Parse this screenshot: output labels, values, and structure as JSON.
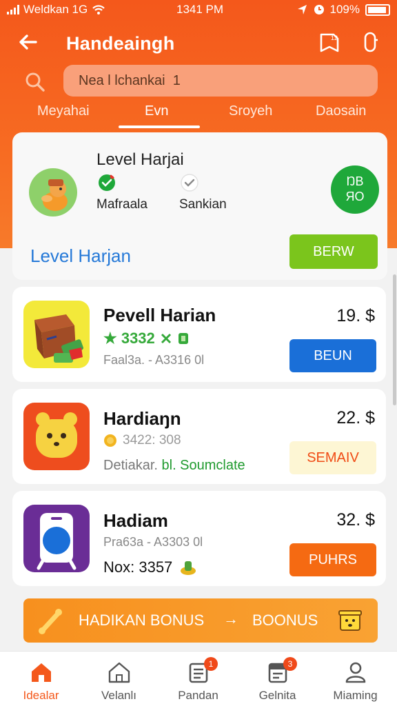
{
  "status_bar": {
    "carrier": "Weldkan 1G",
    "time": "1341 PM",
    "battery": "109%"
  },
  "header": {
    "title": "Handeaingh",
    "back_icon": "arrow-left-icon",
    "icons": [
      "bookmark-icon",
      "phone-icon"
    ]
  },
  "search": {
    "value": "Nea l lchankai  1",
    "icon": "search-icon"
  },
  "tabs": [
    {
      "label": "Meyahai",
      "active": false
    },
    {
      "label": "Evn",
      "active": true
    },
    {
      "label": "Sroyeh",
      "active": false
    },
    {
      "label": "Daosain",
      "active": false
    }
  ],
  "level_card": {
    "title": "Level Harjai",
    "check1_label": "Mafraala",
    "check2_label": "Sankian",
    "xp_line1": "ŊB",
    "xp_line2": "ЯO",
    "link_text": "Level Harjan",
    "button_label": "BERW"
  },
  "items": [
    {
      "name": "Pevell Harian",
      "price": "19. $",
      "stars_text": "★ 3332",
      "subtitle": "Faal3a. - A3316 0l",
      "button": "BEUN",
      "button_color": "#1a6fd8"
    },
    {
      "name": "Hardiaŋn",
      "price": "22. $",
      "coin_text": "3422: 308",
      "detail_prefix": "Detiakar.",
      "detail_link": "bl. Soumclate",
      "button": "SEMAIV",
      "button_color": "#fdf6d4"
    },
    {
      "name": "Hadiam",
      "price": "32. $",
      "subtitle": "Pra63a - A3303 0l",
      "nox": "Nox: 3357",
      "button": "PUHRS",
      "button_color": "#f56a12"
    }
  ],
  "bonus": {
    "left": "HADIKAN BONUS",
    "arrow": "→",
    "right": "BOONUS"
  },
  "bottom_nav": [
    {
      "label": "Idealar",
      "icon": "home-icon",
      "active": true
    },
    {
      "label": "Velanlı",
      "icon": "home-outline-icon",
      "active": false
    },
    {
      "label": "Pandan",
      "icon": "document-icon",
      "badge": "1",
      "active": false
    },
    {
      "label": "Gelnita",
      "icon": "calendar-icon",
      "badge": "3",
      "active": false
    },
    {
      "label": "Miaming",
      "icon": "user-icon",
      "active": false
    }
  ]
}
